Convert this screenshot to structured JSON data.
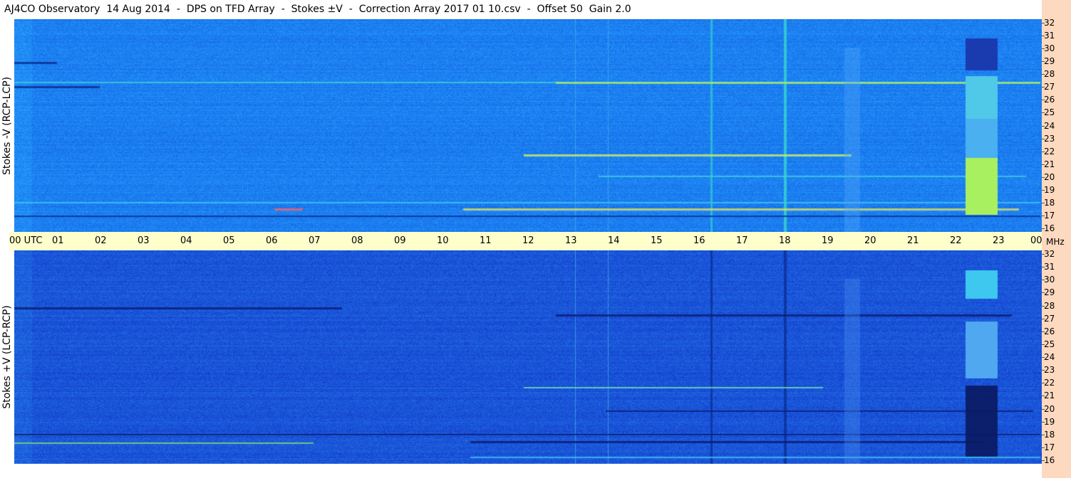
{
  "title": "AJ4CO Observatory  14 Aug 2014  -  DPS on TFD Array  -  Stokes ±V  -  Correction Array 2017 01 10.csv  -  Offset 50  Gain 2.0",
  "panels": [
    {
      "label": "Stokes -V (RCP-LCP)",
      "base_color": "#1c7ff0",
      "palette": "bright"
    },
    {
      "label": "Stokes +V (LCP-RCP)",
      "base_color": "#1a55d8",
      "palette": "dark"
    }
  ],
  "time_axis": {
    "labels": [
      "00  UTC",
      "01",
      "02",
      "03",
      "04",
      "05",
      "06",
      "07",
      "08",
      "09",
      "10",
      "11",
      "12",
      "13",
      "14",
      "15",
      "16",
      "17",
      "18",
      "19",
      "20",
      "21",
      "22",
      "23",
      "00"
    ],
    "background": "#ffffcc"
  },
  "freq_axis": {
    "unit": "MHz",
    "labels": [
      "32",
      "31",
      "30",
      "29",
      "28",
      "27",
      "26",
      "25",
      "24",
      "23",
      "22",
      "21",
      "20",
      "19",
      "18",
      "17",
      "16"
    ],
    "background": "#fcd9bf"
  }
}
